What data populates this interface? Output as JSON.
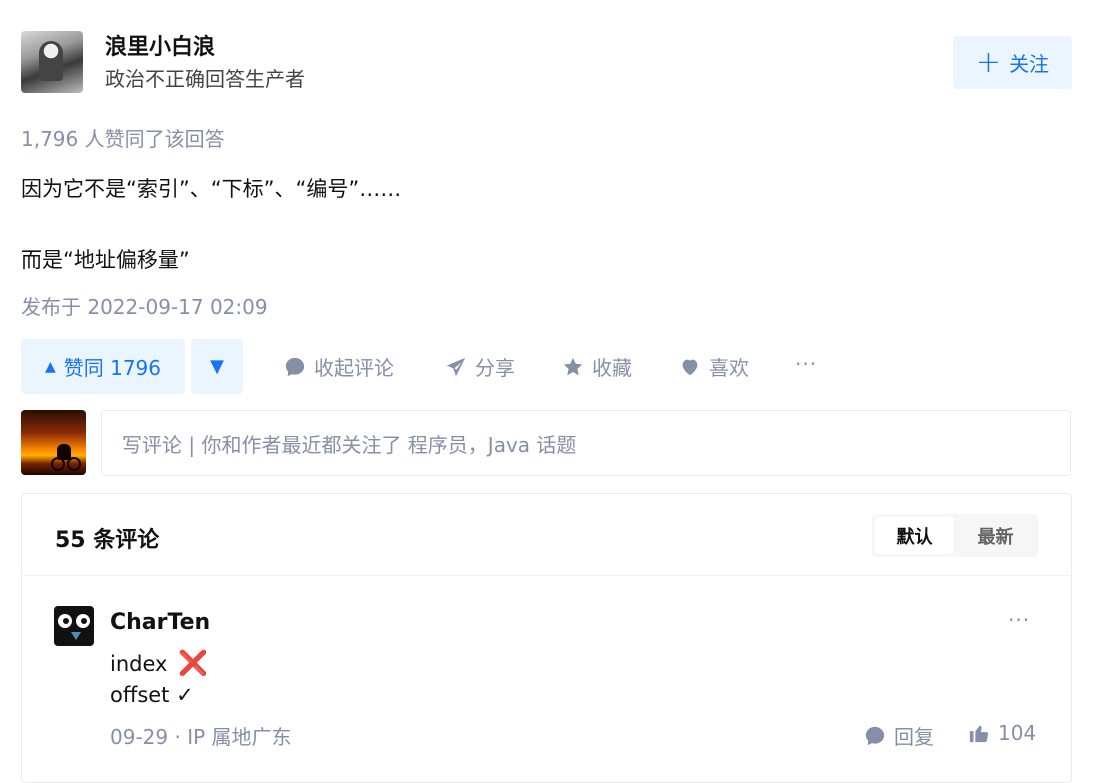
{
  "author": {
    "name": "浪里小白浪",
    "bio": "政治不正确回答生产者",
    "follow_label": "关注"
  },
  "answer": {
    "voters_text": "1,796 人赞同了该回答",
    "lines": [
      "因为它不是“索引”、“下标”、“编号”……",
      "而是“地址偏移量”"
    ],
    "published": "发布于 2022-09-17 02:09"
  },
  "actions": {
    "upvote_label": "赞同 1796",
    "comments_label": "收起评论",
    "share_label": "分享",
    "favorite_label": "收藏",
    "like_label": "喜欢",
    "more_label": "···"
  },
  "comment_input": {
    "placeholder": "写评论 | 你和作者最近都关注了 程序员，Java 话题"
  },
  "comments_panel": {
    "count_label": "55 条评论",
    "sort_default": "默认",
    "sort_latest": "最新"
  },
  "comments": [
    {
      "author": "CharTen",
      "line1": "index",
      "line1_mark": "❌",
      "line2": "offset ✓",
      "meta": "09-29 · IP 属地广东",
      "reply_label": "回复",
      "likes": "104",
      "more": "···"
    }
  ],
  "colors": {
    "accent": "#1772f6",
    "accent_bg": "#ebf5ff",
    "muted": "#8590a6"
  }
}
